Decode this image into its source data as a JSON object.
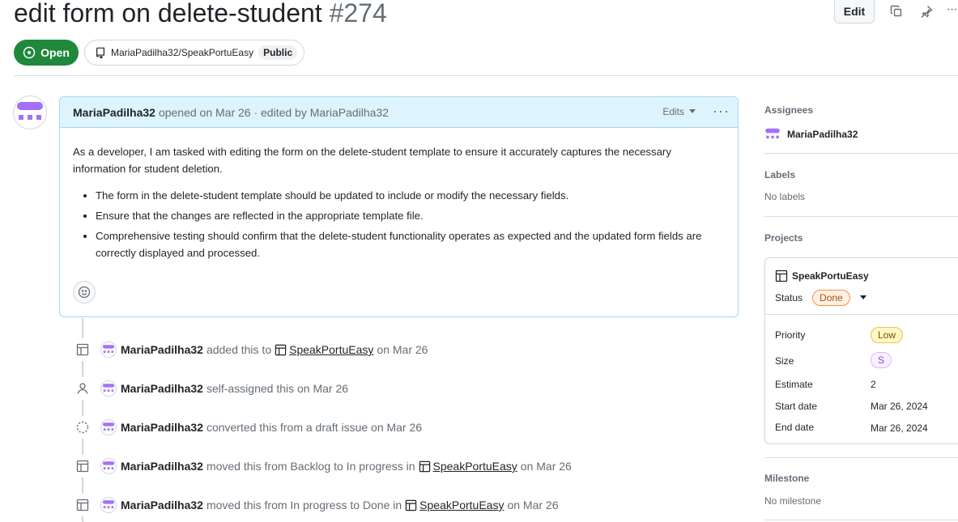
{
  "issue": {
    "title": "edit form on delete-student",
    "number": "#274",
    "state": "Open",
    "repo": "MariaPadilha32/SpeakPortuEasy",
    "visibility": "Public"
  },
  "header": {
    "edit_label": "Edit",
    "copy_icon": "copy-icon",
    "pin_icon": "pin-icon",
    "more_icon": "kebab-horizontal-icon",
    "more_label": "···"
  },
  "comment": {
    "author": "MariaPadilha32",
    "meta": "opened on Mar 26 · edited by MariaPadilha32",
    "edits_label": "Edits",
    "more_label": "···",
    "paragraph": "As a developer, I am tasked with editing the form on the delete-student template to ensure it accurately captures the necessary information for student deletion.",
    "bullets": [
      "The form in the delete-student template should be updated to include or modify the necessary fields.",
      "Ensure that the changes are reflected in the appropriate template file.",
      "Comprehensive testing should confirm that the delete-student functionality operates as expected and the updated form fields are correctly displayed and processed."
    ]
  },
  "timeline": [
    {
      "icon": "table-icon",
      "actor": "MariaPadilha32",
      "pre": "added this to",
      "project": "SpeakPortuEasy",
      "post": "on Mar 26"
    },
    {
      "icon": "person-icon",
      "actor": "MariaPadilha32",
      "pre": "self-assigned this on Mar 26",
      "project": "",
      "post": ""
    },
    {
      "icon": "draft-issue-icon",
      "actor": "MariaPadilha32",
      "pre": "converted this from a draft issue on Mar 26",
      "project": "",
      "post": ""
    },
    {
      "icon": "table-icon",
      "actor": "MariaPadilha32",
      "pre": "moved this from Backlog to In progress in",
      "project": "SpeakPortuEasy",
      "post": "on Mar 26"
    },
    {
      "icon": "table-icon",
      "actor": "MariaPadilha32",
      "pre": "moved this from In progress to Done in",
      "project": "SpeakPortuEasy",
      "post": "on Mar 26"
    }
  ],
  "sidebar": {
    "assignees": {
      "heading": "Assignees",
      "user": "MariaPadilha32"
    },
    "labels": {
      "heading": "Labels",
      "empty": "No labels"
    },
    "projects": {
      "heading": "Projects",
      "name": "SpeakPortuEasy",
      "status_label": "Status",
      "status_value": "Done",
      "fields": [
        {
          "label": "Priority",
          "value": "Low"
        },
        {
          "label": "Size",
          "value": "S"
        },
        {
          "label": "Estimate",
          "value": "2"
        },
        {
          "label": "Start date",
          "value": "Mar 26, 2024"
        },
        {
          "label": "End date",
          "value": "Mar 26, 2024"
        }
      ]
    },
    "milestone": {
      "heading": "Milestone",
      "empty": "No milestone"
    }
  },
  "colors": {
    "open_green": "#1f883d",
    "header_blue": "#ddf4ff",
    "avatar_purple": "#a371f7"
  }
}
